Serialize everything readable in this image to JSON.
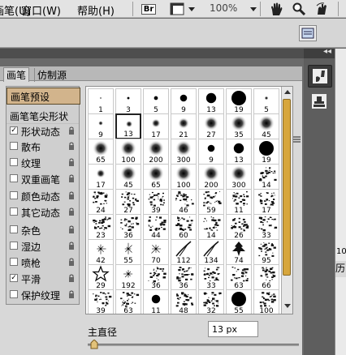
{
  "menubar": {
    "items": [
      "画笔(U)",
      "窗口(W)",
      "帮助(H)"
    ],
    "br_label": "Br",
    "zoom": "100%"
  },
  "panel": {
    "tabs": [
      "画笔",
      "仿制源"
    ],
    "list": [
      {
        "label": "画笔预设",
        "checkbox": false,
        "checked": false,
        "lock": false,
        "highlight": true
      },
      {
        "label": "画笔笔尖形状",
        "checkbox": false,
        "checked": false,
        "lock": false,
        "highlight": false
      },
      {
        "label": "形状动态",
        "checkbox": true,
        "checked": true,
        "lock": true
      },
      {
        "label": "散布",
        "checkbox": true,
        "checked": false,
        "lock": true
      },
      {
        "label": "纹理",
        "checkbox": true,
        "checked": false,
        "lock": true
      },
      {
        "label": "双重画笔",
        "checkbox": true,
        "checked": false,
        "lock": true
      },
      {
        "label": "颜色动态",
        "checkbox": true,
        "checked": false,
        "lock": true
      },
      {
        "label": "其它动态",
        "checkbox": true,
        "checked": false,
        "lock": true
      },
      {
        "label": "杂色",
        "checkbox": true,
        "checked": false,
        "lock": true
      },
      {
        "label": "湿边",
        "checkbox": true,
        "checked": false,
        "lock": true
      },
      {
        "label": "喷枪",
        "checkbox": true,
        "checked": false,
        "lock": true
      },
      {
        "label": "平滑",
        "checkbox": true,
        "checked": true,
        "lock": true
      },
      {
        "label": "保护纹理",
        "checkbox": true,
        "checked": false,
        "lock": true
      }
    ],
    "brush_sizes": [
      [
        "1",
        "3",
        "5",
        "9",
        "13",
        "19",
        "5"
      ],
      [
        "9",
        "13",
        "17",
        "21",
        "27",
        "35",
        "45"
      ],
      [
        "65",
        "100",
        "200",
        "300",
        "9",
        "13",
        "19"
      ],
      [
        "17",
        "45",
        "65",
        "100",
        "200",
        "300",
        "14"
      ],
      [
        "24",
        "27",
        "39",
        "46",
        "59",
        "11",
        "17"
      ],
      [
        "23",
        "36",
        "44",
        "60",
        "14",
        "26",
        "33"
      ],
      [
        "42",
        "55",
        "70",
        "112",
        "134",
        "74",
        "95"
      ],
      [
        "29",
        "192",
        "36",
        "36",
        "33",
        "63",
        "66"
      ],
      [
        "39",
        "63",
        "11",
        "48",
        "32",
        "55",
        "100"
      ]
    ],
    "brush_types": [
      [
        "h",
        "h",
        "h",
        "h",
        "h",
        "h",
        "s"
      ],
      [
        "s",
        "s",
        "s",
        "s",
        "s",
        "s",
        "s"
      ],
      [
        "s",
        "s",
        "s",
        "s",
        "h",
        "h",
        "h"
      ],
      [
        "s",
        "s",
        "s",
        "s",
        "s",
        "s",
        "t"
      ],
      [
        "t",
        "t",
        "t",
        "t",
        "t",
        "t",
        "t"
      ],
      [
        "t",
        "t",
        "t",
        "t",
        "t",
        "t",
        "t"
      ],
      [
        "a",
        "a",
        "a",
        "g",
        "g",
        "l",
        "t"
      ],
      [
        "star",
        "a",
        "t",
        "t",
        "t",
        "t",
        "t"
      ],
      [
        "t",
        "t",
        "h",
        "t",
        "t",
        "h",
        "t"
      ]
    ],
    "selected_cell": "1-1",
    "diameter_label": "主直径",
    "diameter_value": "13 px",
    "diameter_fraction": 0.03
  },
  "right_strip": {
    "text_1": "10",
    "text_2": "历"
  }
}
